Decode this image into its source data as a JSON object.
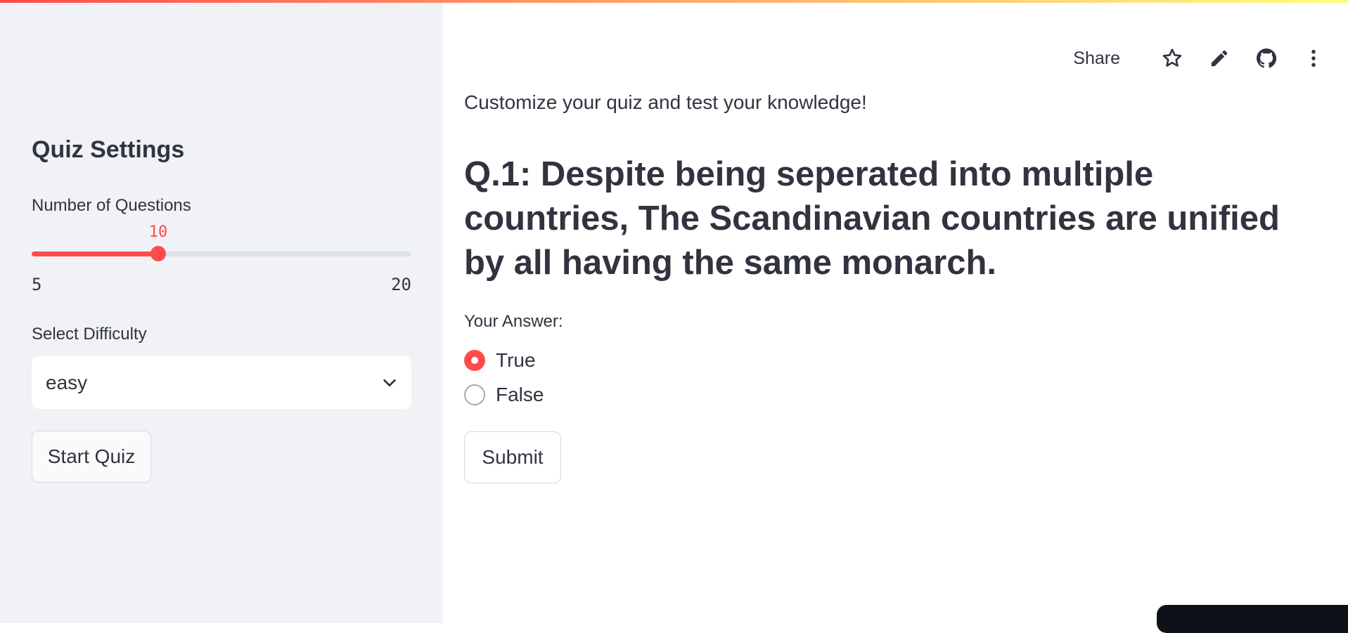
{
  "sidebar": {
    "title": "Quiz Settings",
    "num_questions": {
      "label": "Number of Questions",
      "value": 10,
      "value_text": "10",
      "min": 5,
      "min_text": "5",
      "max": 20,
      "max_text": "20"
    },
    "difficulty": {
      "label": "Select Difficulty",
      "selected": "easy"
    },
    "start_button": "Start Quiz"
  },
  "toolbar": {
    "share_label": "Share",
    "icons": [
      "star-icon",
      "pencil-icon",
      "github-icon",
      "more-vertical-icon"
    ]
  },
  "main": {
    "subtitle": "Customize your quiz and test your knowledge!",
    "question": "Q.1: Despite being seperated into multiple countries, The Scandinavian countries are unified by all having the same monarch.",
    "answer_label": "Your Answer:",
    "options": [
      {
        "label": "True",
        "selected": true
      },
      {
        "label": "False",
        "selected": false
      }
    ],
    "submit_button": "Submit"
  },
  "colors": {
    "accent": "#ff4b4b",
    "sidebar_bg": "#f0f2f6",
    "text": "#31333f"
  }
}
